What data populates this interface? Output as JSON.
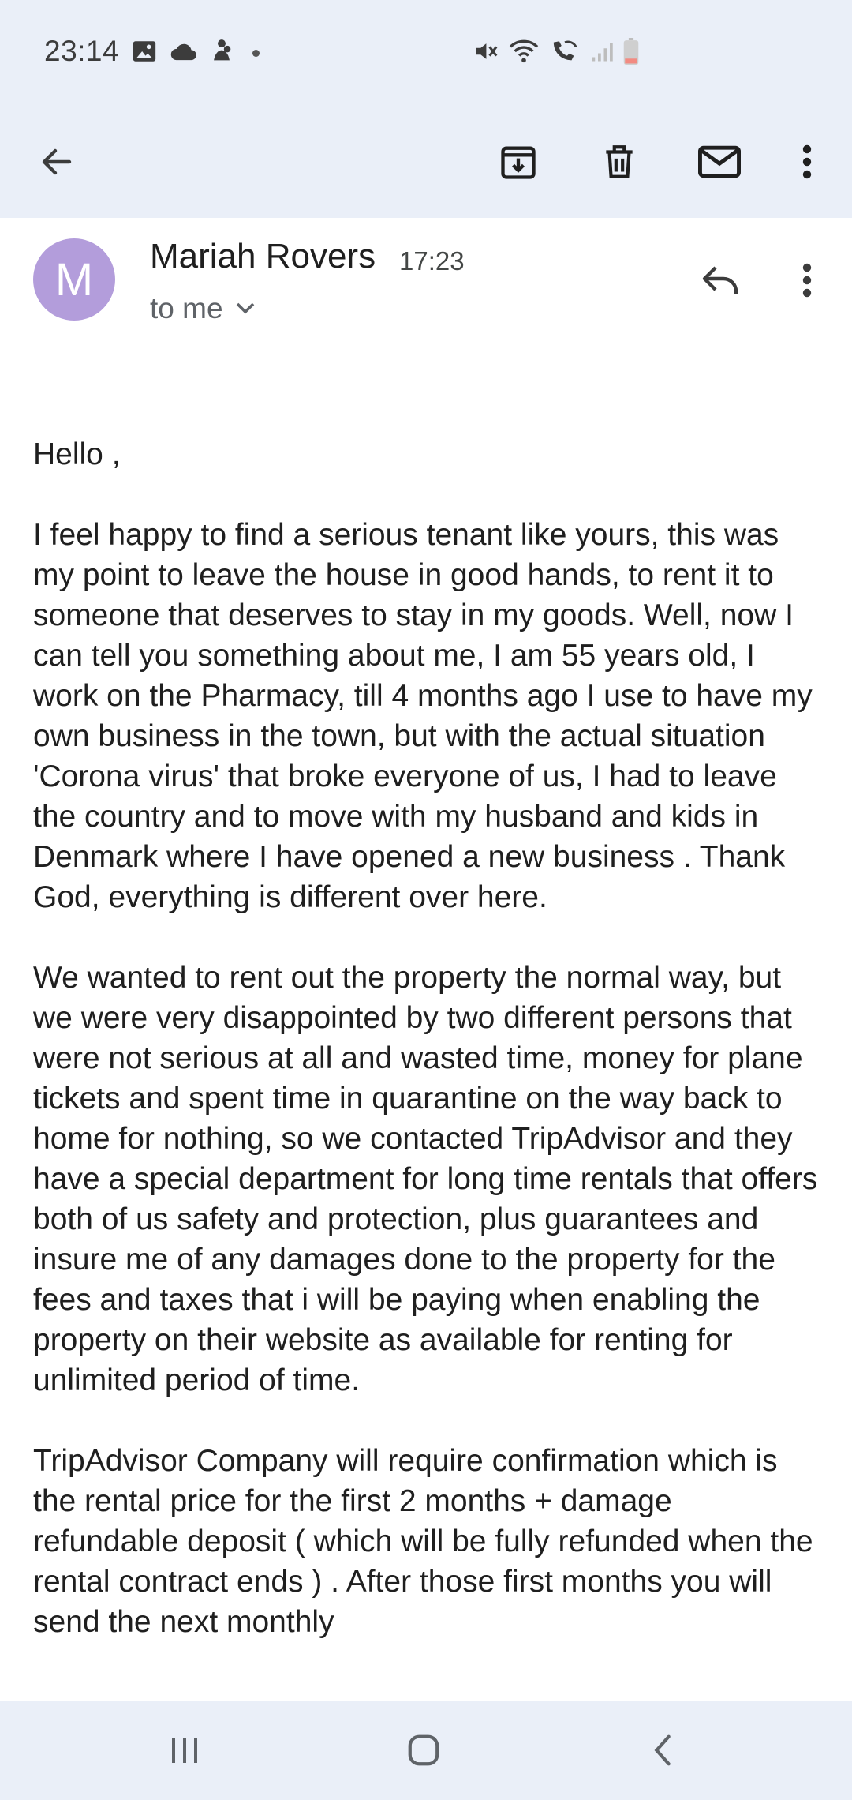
{
  "status_bar": {
    "time": "23:14",
    "left_icons": [
      "gallery-icon",
      "cloud-icon",
      "notification-icon",
      "dot-icon"
    ],
    "right_icons": [
      "mute-icon",
      "wifi-icon",
      "wifi-calling-icon",
      "signal-icon",
      "battery-icon"
    ],
    "battery_color": "#f28b82"
  },
  "toolbar": {
    "icons": [
      "back-arrow-icon",
      "archive-icon",
      "delete-icon",
      "mark-unread-icon",
      "more-vert-icon"
    ]
  },
  "email": {
    "avatar_letter": "M",
    "avatar_color": "#b39ddb",
    "sender": "Mariah Rovers",
    "time": "17:23",
    "recipient": "to me",
    "paragraphs": [
      "Hello ,",
      "I feel happy to find a serious tenant like yours, this was my point to leave the house in good hands, to rent it to someone that deserves to stay in my goods. Well, now I can tell you something about me, I am 55 years old, I work on the Pharmacy, till 4 months ago I use to have my own business in the town, but with the actual situation 'Corona virus' that broke everyone of us, I had to leave the country and to move with my husband and kids in Denmark where I have opened a new business . Thank God, everything is different over here.",
      "We wanted to rent out the property the normal way, but we were very disappointed by two different persons that were not serious at all and wasted time, money for plane tickets and spent time in quarantine on the way back to home for nothing, so we contacted TripAdvisor and they have a special department for long time rentals that offers both of us safety and protection, plus guarantees and insure me of any damages done to the property for the fees and taxes that i will be paying when enabling the property on their website as available for renting for unlimited period of time.",
      "TripAdvisor Company will require confirmation which is the rental price for the first 2 months + damage refundable deposit ( which will be fully refunded when the rental contract ends ) . After those first months you will send the next monthly"
    ]
  },
  "nav_bar": {
    "icons": [
      "recent-apps-icon",
      "home-icon",
      "nav-back-icon"
    ]
  }
}
